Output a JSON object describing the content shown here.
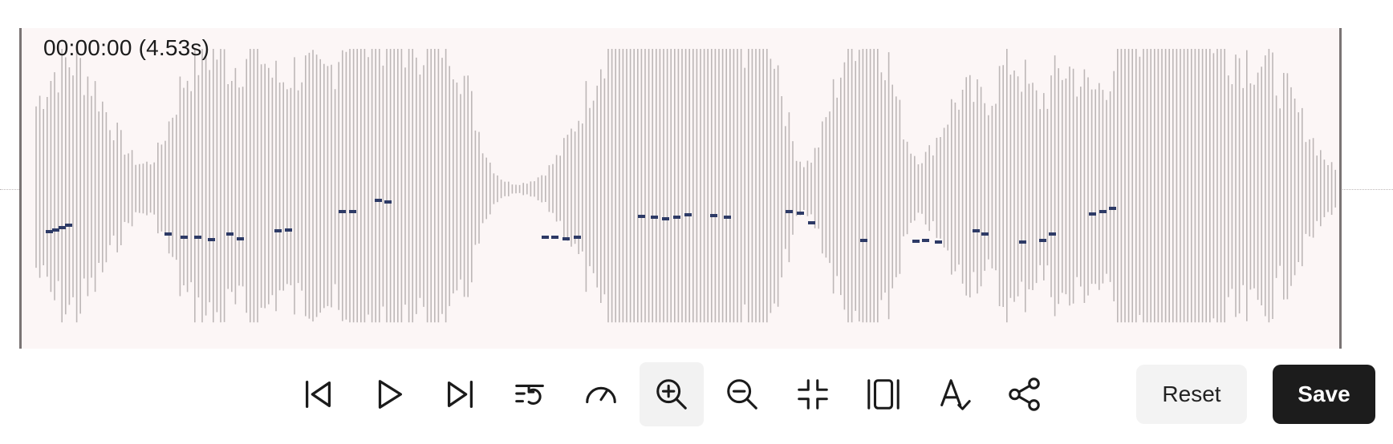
{
  "player": {
    "time_readout": "00:00:00 (4.53s)"
  },
  "colors": {
    "waveform_background": "#fcf6f6",
    "waveform_bars": "#bdb7b7",
    "pitch_marks": "#2d3a66",
    "save_button": "#1c1c1c",
    "reset_button": "#f3f3f3"
  },
  "toolbar": {
    "buttons": [
      {
        "icon": "skip-back-icon",
        "active": false
      },
      {
        "icon": "play-icon",
        "active": false
      },
      {
        "icon": "skip-forward-icon",
        "active": false
      },
      {
        "icon": "replay-list-icon",
        "active": false
      },
      {
        "icon": "speed-gauge-icon",
        "active": false
      },
      {
        "icon": "zoom-in-icon",
        "active": true
      },
      {
        "icon": "zoom-out-icon",
        "active": false
      },
      {
        "icon": "shrink-icon",
        "active": false
      },
      {
        "icon": "fit-view-icon",
        "active": false
      },
      {
        "icon": "spellcheck-icon",
        "active": false
      },
      {
        "icon": "share-icon",
        "active": false
      }
    ],
    "reset_label": "Reset",
    "save_label": "Save"
  }
}
